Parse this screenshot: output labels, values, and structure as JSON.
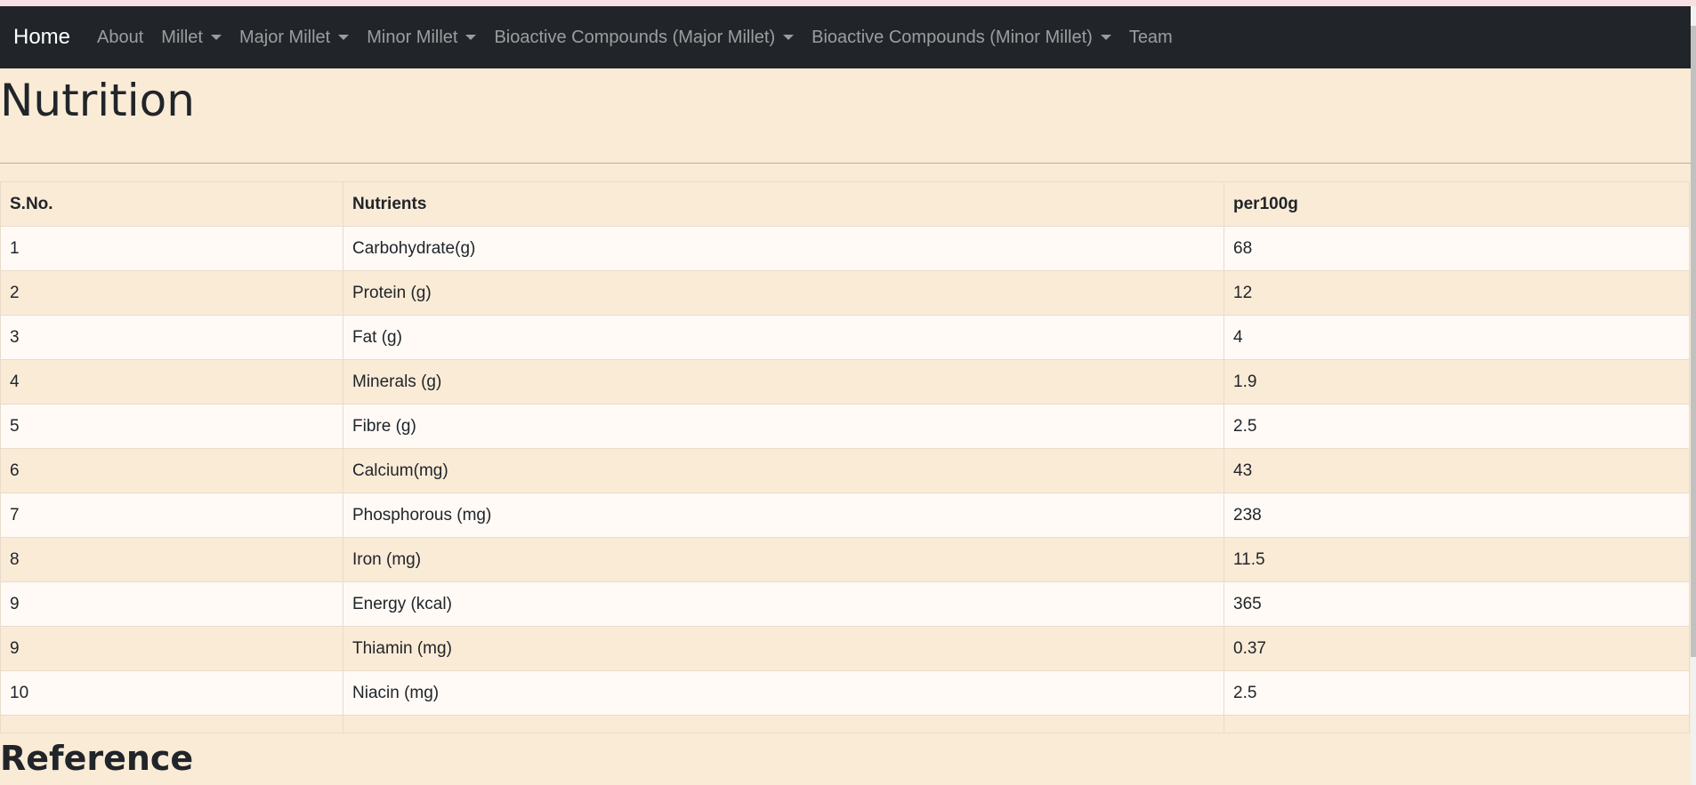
{
  "nav": {
    "brand": "Home",
    "items": [
      {
        "label": "About",
        "dropdown": false
      },
      {
        "label": "Millet",
        "dropdown": true
      },
      {
        "label": "Major Millet",
        "dropdown": true
      },
      {
        "label": "Minor Millet",
        "dropdown": true
      },
      {
        "label": "Bioactive Compounds (Major Millet)",
        "dropdown": true
      },
      {
        "label": "Bioactive Compounds (Minor Millet)",
        "dropdown": true
      },
      {
        "label": "Team",
        "dropdown": false
      }
    ]
  },
  "page": {
    "title": "Nutrition",
    "reference_heading": "Reference"
  },
  "table": {
    "headers": [
      "S.No.",
      "Nutrients",
      "per100g"
    ],
    "rows": [
      [
        "1",
        "Carbohydrate(g)",
        "68"
      ],
      [
        "2",
        "Protein (g)",
        "12"
      ],
      [
        "3",
        "Fat (g)",
        "4"
      ],
      [
        "4",
        "Minerals (g)",
        "1.9"
      ],
      [
        "5",
        "Fibre (g)",
        "2.5"
      ],
      [
        "6",
        "Calcium(mg)",
        "43"
      ],
      [
        "7",
        "Phosphorous (mg)",
        "238"
      ],
      [
        "8",
        "Iron (mg)",
        "11.5"
      ],
      [
        "9",
        "Energy (kcal)",
        "365"
      ],
      [
        "9",
        "Thiamin (mg)",
        "0.37"
      ],
      [
        "10",
        "Niacin (mg)",
        "2.5"
      ]
    ]
  },
  "colors": {
    "navbar": "#212529",
    "page_background": "#faebd7",
    "row_light": "#fffaf6"
  }
}
